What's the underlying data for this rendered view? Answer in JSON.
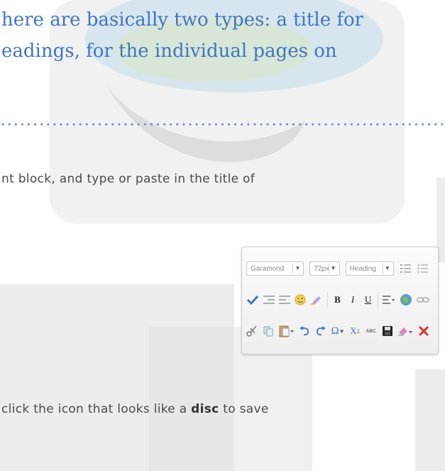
{
  "heading": {
    "line1": "here are basically two types: a title for",
    "line2": "eadings, for the individual pages on"
  },
  "paragraphs": {
    "p1": "nt block, and type or paste in the title of",
    "p2_before": "click the icon that looks like a ",
    "p2_bold": "disc",
    "p2_after": " to save"
  },
  "toolbar": {
    "font_select": "Garamond",
    "size_select": "72px",
    "format_select": "Heading",
    "row2_icons": [
      "spellcheck-icon",
      "outdent-icon",
      "indent-icon",
      "emoticon-icon",
      "highlighter-icon",
      "bold-icon",
      "italic-icon",
      "underline-icon",
      "align-icon",
      "globe-icon",
      "link-icon"
    ],
    "row3_icons": [
      "cut-icon",
      "copy-icon",
      "paste-icon",
      "undo-icon",
      "redo-icon",
      "special-char-icon",
      "subscript-icon",
      "abc-icon",
      "save-disc-icon",
      "eraser-icon",
      "delete-icon"
    ],
    "bold_label": "B",
    "italic_label": "I",
    "underline_label": "U",
    "omega_label": "Ω",
    "subscript_label": "X",
    "abc_label": "ABC"
  },
  "colors": {
    "heading": "#3f76c2",
    "body_text": "#4a4a4a",
    "dotted_rule": "#5b8fd6",
    "delete": "#d9342b"
  }
}
